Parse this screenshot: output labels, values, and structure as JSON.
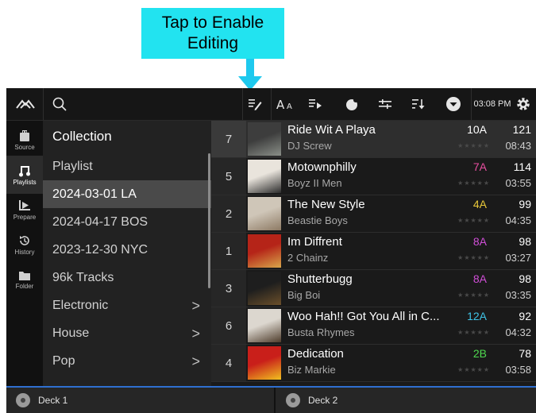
{
  "callout": {
    "line1": "Tap to Enable",
    "line2": "Editing",
    "color": "#22e3f0"
  },
  "topbar": {
    "clock": "03:08 PM",
    "icons": [
      "logo-icon",
      "search-icon",
      "edit-pencil-icon",
      "font-size-icon",
      "add-to-queue-icon",
      "prep-icon",
      "filter-icon",
      "sort-icon",
      "dropdown-icon",
      "settings-gear-icon"
    ]
  },
  "rail": {
    "items": [
      {
        "label": "Source",
        "icon": "source-icon"
      },
      {
        "label": "Playlists",
        "icon": "music-note-icon",
        "active": true
      },
      {
        "label": "Prepare",
        "icon": "prepare-icon"
      },
      {
        "label": "History",
        "icon": "history-icon"
      },
      {
        "label": "Folder",
        "icon": "folder-icon"
      }
    ]
  },
  "playlists": {
    "header": "Collection",
    "items": [
      {
        "label": "Playlist"
      },
      {
        "label": "2024-03-01 LA",
        "selected": true
      },
      {
        "label": "2024-04-17 BOS"
      },
      {
        "label": "2023-12-30 NYC"
      },
      {
        "label": "96k Tracks"
      },
      {
        "label": "Electronic",
        "has_children": true
      },
      {
        "label": "House",
        "has_children": true
      },
      {
        "label": "Pop",
        "has_children": true
      }
    ]
  },
  "tracks": [
    {
      "num": "7",
      "title": "Ride Wit A Playa",
      "artist": "DJ Screw",
      "key": "10A",
      "key_color": "#ffffff",
      "bpm": "121",
      "time": "08:43",
      "stars": "★★★★★",
      "art": [
        "#3d3d3d",
        "#8a8f88"
      ]
    },
    {
      "num": "5",
      "title": "Motownphilly",
      "artist": "Boyz II Men",
      "key": "7A",
      "key_color": "#e84fa0",
      "bpm": "114",
      "time": "03:55",
      "stars": "★★★★★",
      "art": [
        "#e9e4dc",
        "#2b2b2b"
      ]
    },
    {
      "num": "2",
      "title": "The New Style",
      "artist": "Beastie Boys",
      "key": "4A",
      "key_color": "#e8c83a",
      "bpm": "99",
      "time": "04:35",
      "stars": "★★★★★",
      "art": [
        "#cfc6b8",
        "#8d7a64"
      ]
    },
    {
      "num": "1",
      "title": "Im Diffrent",
      "artist": "2 Chainz",
      "key": "8A",
      "key_color": "#d14fd8",
      "bpm": "98",
      "time": "03:27",
      "stars": "★★★★★",
      "art": [
        "#b52418",
        "#d8a64a"
      ]
    },
    {
      "num": "3",
      "title": "Shutterbugg",
      "artist": "Big Boi",
      "key": "8A",
      "key_color": "#d14fd8",
      "bpm": "98",
      "time": "03:35",
      "stars": "★★★★★",
      "art": [
        "#1e1e1e",
        "#6b4f2a"
      ]
    },
    {
      "num": "6",
      "title": "Woo Hah!! Got You All in C...",
      "artist": "Busta Rhymes",
      "key": "12A",
      "key_color": "#3fc3e6",
      "bpm": "92",
      "time": "04:32",
      "stars": "★★★★★",
      "art": [
        "#dcd7cf",
        "#4d3b2a"
      ]
    },
    {
      "num": "4",
      "title": "Dedication",
      "artist": "Biz Markie",
      "key": "2B",
      "key_color": "#4fd84f",
      "bpm": "78",
      "time": "03:58",
      "stars": "★★★★★",
      "art": [
        "#c91f1a",
        "#f0c020"
      ]
    }
  ],
  "decks": [
    {
      "label": "Deck 1"
    },
    {
      "label": "Deck 2"
    }
  ]
}
